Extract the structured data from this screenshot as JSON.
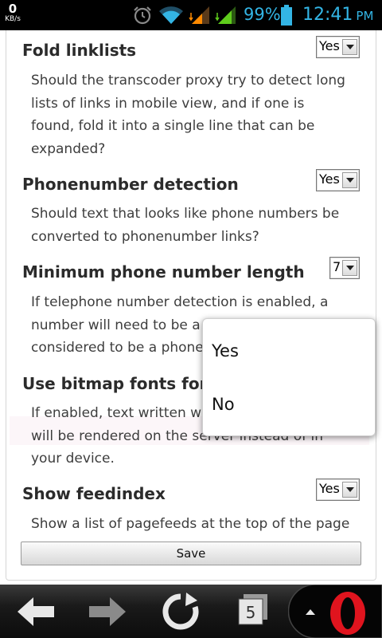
{
  "status_bar": {
    "net_speed_value": "0",
    "net_speed_unit": "KB/s",
    "battery_percent": "99%",
    "time": "12:41",
    "ampm": "PM",
    "accent_color": "#33b5e5",
    "icons": [
      "alarm-icon",
      "wifi-icon",
      "signal-icon",
      "signal-icon",
      "battery-icon"
    ]
  },
  "settings": [
    {
      "title": "Fold linklists",
      "description": [
        "Should the transcoder proxy try to detect long",
        "lists of links in mobile view, and if one is",
        "found, fold it into a single line that can be",
        "expanded?"
      ],
      "value": "Yes"
    },
    {
      "title": "Phonenumber detection",
      "description": [
        "Should text that looks like phone numbers be",
        "converted to phonenumber links?"
      ],
      "value": "Yes"
    },
    {
      "title": "Minimum phone number length",
      "description": [
        "If telephone number detection is enabled, a",
        "number will need to be a",
        "considered to be a phone"
      ],
      "value": "7"
    },
    {
      "title": "Use bitmap fonts for co",
      "description": [
        "If enabled, text written wi",
        "will be rendered on the server instead of in",
        "your device."
      ]
    },
    {
      "title": "Show feedindex",
      "description": [
        "Show a list of pagefeeds at the top of the page"
      ],
      "value": "Yes"
    }
  ],
  "save_label": "Save",
  "popup": {
    "options": [
      "Yes",
      "No"
    ]
  },
  "nav": {
    "tab_count": "5",
    "icons": [
      "back-arrow-icon",
      "forward-arrow-icon",
      "reload-icon",
      "tabs-icon",
      "opera-menu-icon"
    ]
  }
}
